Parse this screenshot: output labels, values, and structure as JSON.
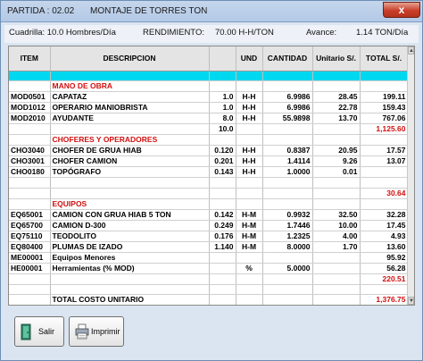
{
  "window": {
    "partida": "PARTIDA : 02.02",
    "title": "MONTAJE DE TORRES    TON",
    "close_glyph": "x"
  },
  "info": {
    "cuadrilla": "Cuadrilla: 10.0 Hombres/Día",
    "rendimiento": "RENDIMIENTO:",
    "rendimiento_value": "70.00 H-H/TON",
    "avance": "Avance:",
    "avance_value": "1.14 TON/Día"
  },
  "columns": {
    "item": "ITEM",
    "descripcion": "DESCRIPCION",
    "und": "UND",
    "cantidad": "CANTIDAD",
    "unitario": "Unitario S/.",
    "total": "TOTAL S/."
  },
  "rows": [
    {
      "item": "",
      "desc": "MANO DE OBRA",
      "f": "",
      "und": "",
      "cant": "",
      "unit": "",
      "total": "",
      "section": true
    },
    {
      "item": "MOD0501",
      "desc": "CAPATAZ",
      "f": "1.0",
      "und": "H-H",
      "cant": "6.9986",
      "unit": "28.45",
      "total": "199.11"
    },
    {
      "item": "MOD1012",
      "desc": "OPERARIO MANIOBRISTA",
      "f": "1.0",
      "und": "H-H",
      "cant": "6.9986",
      "unit": "22.78",
      "total": "159.43"
    },
    {
      "item": "MOD2010",
      "desc": "AYUDANTE",
      "f": "8.0",
      "und": "H-H",
      "cant": "55.9898",
      "unit": "13.70",
      "total": "767.06"
    },
    {
      "item": "",
      "desc": "",
      "f": "10.0",
      "und": "",
      "cant": "",
      "unit": "",
      "total": "1,125.60",
      "totalRed": true
    },
    {
      "item": "",
      "desc": "CHOFERES Y OPERADORES",
      "f": "",
      "und": "",
      "cant": "",
      "unit": "",
      "total": "",
      "section": true
    },
    {
      "item": "CHO3040",
      "desc": "CHOFER DE GRUA HIAB",
      "f": "0.120",
      "und": "H-H",
      "cant": "0.8387",
      "unit": "20.95",
      "total": "17.57"
    },
    {
      "item": "CHO3001",
      "desc": "CHOFER CAMION",
      "f": "0.201",
      "und": "H-H",
      "cant": "1.4114",
      "unit": "9.26",
      "total": "13.07"
    },
    {
      "item": "CHO0180",
      "desc": "TOPÓGRAFO",
      "f": "0.143",
      "und": "H-H",
      "cant": "1.0000",
      "unit": "0.01",
      "total": ""
    },
    {
      "item": "",
      "desc": "",
      "f": "",
      "und": "",
      "cant": "",
      "unit": "",
      "total": ""
    },
    {
      "item": "",
      "desc": "",
      "f": "",
      "und": "",
      "cant": "",
      "unit": "",
      "total": "30.64",
      "totalRed": true
    },
    {
      "item": "",
      "desc": "EQUIPOS",
      "f": "",
      "und": "",
      "cant": "",
      "unit": "",
      "total": "",
      "section": true
    },
    {
      "item": "EQ65001",
      "desc": "CAMION CON GRUA HIAB 5 TON",
      "f": "0.142",
      "und": "H-M",
      "cant": "0.9932",
      "unit": "32.50",
      "total": "32.28"
    },
    {
      "item": "EQ65700",
      "desc": "CAMION D-300",
      "f": "0.249",
      "und": "H-M",
      "cant": "1.7446",
      "unit": "10.00",
      "total": "17.45"
    },
    {
      "item": "EQ75110",
      "desc": "TEODOLITO",
      "f": "0.176",
      "und": "H-M",
      "cant": "1.2325",
      "unit": "4.00",
      "total": "4.93"
    },
    {
      "item": "EQ80400",
      "desc": "PLUMAS DE IZADO",
      "f": "1.140",
      "und": "H-M",
      "cant": "8.0000",
      "unit": "1.70",
      "total": "13.60"
    },
    {
      "item": "ME00001",
      "desc": "Equipos Menores",
      "f": "",
      "und": "",
      "cant": "",
      "unit": "",
      "total": "95.92"
    },
    {
      "item": "HE00001",
      "desc": "Herramientas (% MOD)",
      "f": "",
      "und": "%",
      "cant": "5.0000",
      "unit": "",
      "total": "56.28"
    },
    {
      "item": "",
      "desc": "",
      "f": "",
      "und": "",
      "cant": "",
      "unit": "",
      "total": "220.51",
      "totalRed": true
    },
    {
      "item": "",
      "desc": "",
      "f": "",
      "und": "",
      "cant": "",
      "unit": "",
      "total": ""
    },
    {
      "item": "",
      "desc": "TOTAL COSTO UNITARIO",
      "f": "",
      "und": "",
      "cant": "",
      "unit": "",
      "total": "1,376.75",
      "totalRed": true
    },
    {
      "item": "",
      "desc": "",
      "f": "",
      "und": "",
      "cant": "",
      "unit": "",
      "total": ""
    },
    {
      "item": "",
      "desc": "",
      "f": "",
      "und": "",
      "cant": "",
      "unit": "",
      "total": ""
    },
    {
      "item": "",
      "desc": "",
      "f": "",
      "und": "",
      "cant": "",
      "unit": "",
      "total": ""
    }
  ],
  "buttons": {
    "salir": "Salir",
    "imprimir": "Imprimir"
  },
  "icons": {
    "close": "close-icon",
    "salir": "exit-door-icon",
    "imprimir": "printer-icon"
  },
  "colors": {
    "section_header": "#d01010",
    "highlight_row": "#00d8f0",
    "window_bg": "#dbe5f1"
  }
}
